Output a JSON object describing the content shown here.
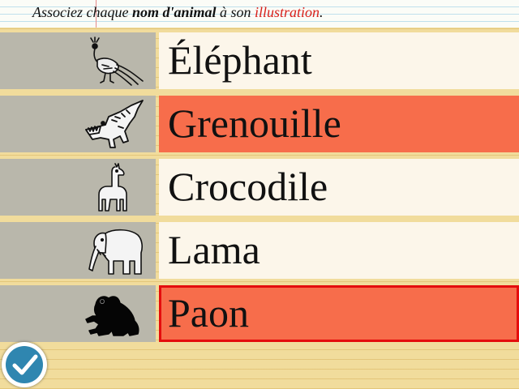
{
  "instruction": {
    "part1": "Associez chaque ",
    "bold": "nom d'animal",
    "part2": " à son ",
    "red": "illustration",
    "part3": "."
  },
  "rows": [
    {
      "icon": "peacock-icon",
      "word": "Éléphant",
      "state": "normal"
    },
    {
      "icon": "crocodile-icon",
      "word": "Grenouille",
      "state": "wrong"
    },
    {
      "icon": "llama-icon",
      "word": "Crocodile",
      "state": "normal"
    },
    {
      "icon": "elephant-icon",
      "word": "Lama",
      "state": "normal"
    },
    {
      "icon": "frog-icon",
      "word": "Paon",
      "state": "wrong-selected"
    }
  ],
  "colors": {
    "wrong": "#f76d4b",
    "selected_border": "#e40d0d",
    "tile": "#b9b7ab",
    "paper": "#f1dc9c",
    "check_button": "#2f86b0"
  },
  "check_button_icon": "checkmark-icon"
}
